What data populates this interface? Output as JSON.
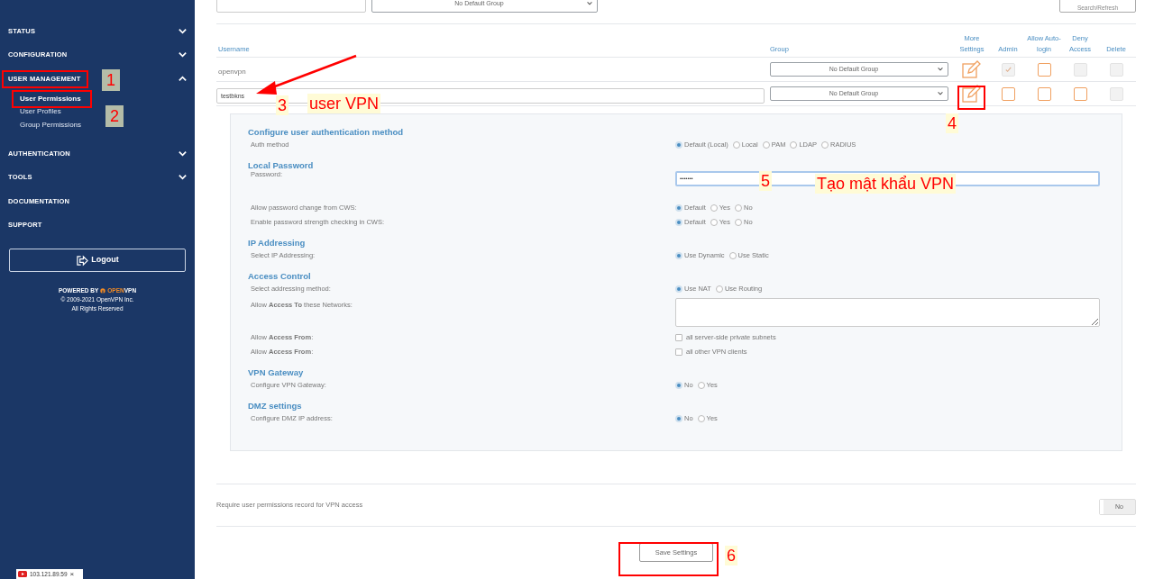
{
  "sidebar": {
    "nav": [
      {
        "label": "STATUS",
        "kind": "section",
        "expanded": false
      },
      {
        "label": "CONFIGURATION",
        "kind": "section",
        "expanded": false
      },
      {
        "label": "USER MANAGEMENT",
        "kind": "section",
        "expanded": true,
        "children": [
          {
            "label": "User Permissions",
            "selected": true
          },
          {
            "label": "User Profiles",
            "selected": false
          },
          {
            "label": "Group Permissions",
            "selected": false
          }
        ]
      },
      {
        "label": "AUTHENTICATION",
        "kind": "section",
        "expanded": false
      },
      {
        "label": "TOOLS",
        "kind": "section",
        "expanded": false
      },
      {
        "label": "DOCUMENTATION",
        "kind": "link"
      },
      {
        "label": "SUPPORT",
        "kind": "link"
      }
    ],
    "logout": "Logout",
    "footer": {
      "powered_by": "POWERED BY",
      "brand_open": "OPEN",
      "brand_vpn": "VPN",
      "copyright": "© 2009-2021 OpenVPN Inc.",
      "rights": "All Rights Reserved"
    }
  },
  "filter": {
    "group": "No Default Group",
    "button": "Search/Refresh"
  },
  "table": {
    "columns": [
      "Username",
      "Group",
      "More Settings",
      "Admin",
      "Allow Auto-login",
      "Deny Access",
      "Delete"
    ],
    "rows": [
      {
        "kind": "text",
        "username": "openvpn",
        "group": "No Default Group",
        "admin": {
          "checked": true,
          "disabled": true
        },
        "auto_login": {
          "checked": false,
          "disabled": false
        },
        "deny": {
          "checked": false,
          "disabled": true
        },
        "delete": {
          "checked": false,
          "disabled": true
        }
      },
      {
        "kind": "input",
        "username": "testbkns",
        "group": "No Default Group",
        "admin": {
          "checked": false,
          "disabled": false
        },
        "auto_login": {
          "checked": false,
          "disabled": false
        },
        "deny": {
          "checked": false,
          "disabled": false
        },
        "delete": {
          "checked": false,
          "disabled": true
        }
      }
    ]
  },
  "user_settings": {
    "sections": [
      {
        "title": "Configure user authentication method",
        "rows": [
          {
            "kind": "radio",
            "label": "Auth method",
            "options": [
              {
                "label": "Default (Local)",
                "selected": true
              },
              {
                "label": "Local",
                "selected": false
              },
              {
                "label": "PAM",
                "selected": false
              },
              {
                "label": "LDAP",
                "selected": false
              },
              {
                "label": "RADIUS",
                "selected": false
              }
            ]
          }
        ]
      },
      {
        "title": "Local Password",
        "rows": [
          {
            "kind": "password",
            "label": "Password:",
            "value": "•••••••"
          },
          {
            "kind": "radio",
            "label": "Allow password change from CWS:",
            "options": [
              {
                "label": "Default",
                "selected": true
              },
              {
                "label": "Yes",
                "selected": false
              },
              {
                "label": "No",
                "selected": false
              }
            ]
          },
          {
            "kind": "radio",
            "label": "Enable password strength checking in CWS:",
            "options": [
              {
                "label": "Default",
                "selected": true
              },
              {
                "label": "Yes",
                "selected": false
              },
              {
                "label": "No",
                "selected": false
              }
            ]
          }
        ]
      },
      {
        "title": "IP Addressing",
        "rows": [
          {
            "kind": "radio",
            "label": "Select IP Addressing:",
            "options": [
              {
                "label": "Use Dynamic",
                "selected": true
              },
              {
                "label": "Use Static",
                "selected": false
              }
            ]
          }
        ]
      },
      {
        "title": "Access Control",
        "rows": [
          {
            "kind": "radio",
            "label": "Select addressing method:",
            "options": [
              {
                "label": "Use NAT",
                "selected": true
              },
              {
                "label": "Use Routing",
                "selected": false
              }
            ]
          },
          {
            "kind": "textarea",
            "label": "Allow **Access To** these Networks:"
          },
          {
            "kind": "checkbox",
            "label": "Allow **Access From**:",
            "option": "all server-side private subnets",
            "checked": false
          },
          {
            "kind": "checkbox",
            "label": "Allow **Access From**:",
            "option": "all other VPN clients",
            "checked": false
          }
        ]
      },
      {
        "title": "VPN Gateway",
        "rows": [
          {
            "kind": "radio",
            "label": "Configure VPN Gateway:",
            "options": [
              {
                "label": "No",
                "selected": true
              },
              {
                "label": "Yes",
                "selected": false
              }
            ]
          }
        ]
      },
      {
        "title": "DMZ settings",
        "rows": [
          {
            "kind": "radio",
            "label": "Configure DMZ IP address:",
            "options": [
              {
                "label": "No",
                "selected": true
              },
              {
                "label": "Yes",
                "selected": false
              }
            ]
          }
        ]
      }
    ]
  },
  "require_permissions": {
    "label": "Require user permissions record for VPN access",
    "toggle": "No",
    "on": false
  },
  "save_button": "Save Settings",
  "taskbar": {
    "address": "103.121.89.59",
    "close": "×"
  },
  "annotations": [
    {
      "kind": "box"
    },
    {
      "kind": "tag",
      "text": "1"
    },
    {
      "kind": "box"
    },
    {
      "kind": "tag",
      "text": "2"
    },
    {
      "kind": "arrow"
    },
    {
      "kind": "note",
      "text": "3"
    },
    {
      "kind": "note",
      "text": "user VPN"
    },
    {
      "kind": "box"
    },
    {
      "kind": "note",
      "text": "4"
    },
    {
      "kind": "note",
      "text": "5"
    },
    {
      "kind": "note",
      "text": "Tạo mật khẩu VPN"
    },
    {
      "kind": "box"
    },
    {
      "kind": "note",
      "text": "6"
    }
  ]
}
